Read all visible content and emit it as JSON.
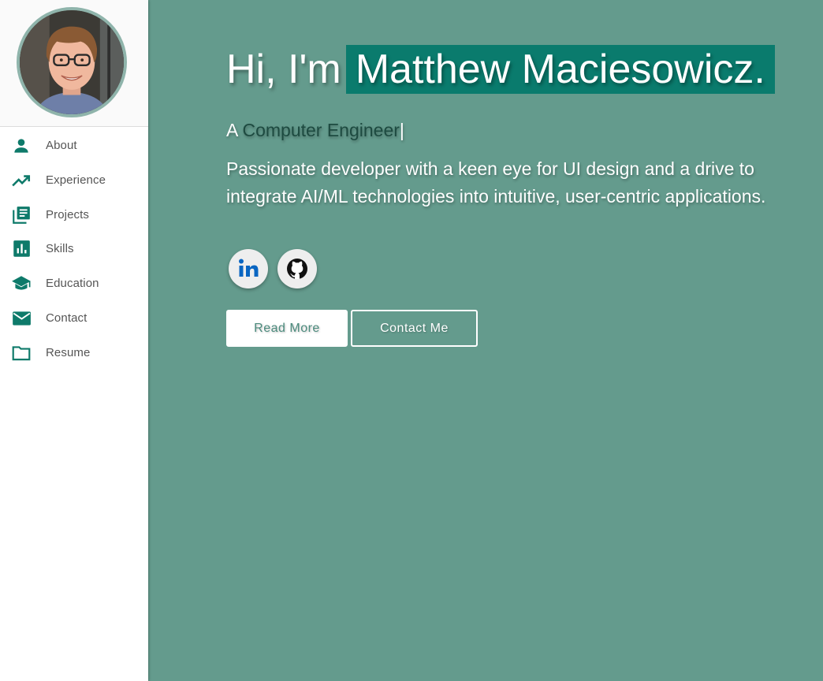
{
  "sidebar": {
    "items": [
      {
        "label": "About",
        "icon": "person-icon"
      },
      {
        "label": "Experience",
        "icon": "trending-up-icon"
      },
      {
        "label": "Projects",
        "icon": "library-books-icon"
      },
      {
        "label": "Skills",
        "icon": "bar-chart-icon"
      },
      {
        "label": "Education",
        "icon": "graduation-cap-icon"
      },
      {
        "label": "Contact",
        "icon": "mail-icon"
      },
      {
        "label": "Resume",
        "icon": "folder-icon"
      }
    ]
  },
  "hero": {
    "greeting_prefix": "Hi, I'm",
    "name": "Matthew Maciesowicz.",
    "role_prefix": "A",
    "role": "Computer Engineer",
    "cursor": "|",
    "tagline": "Passionate developer with a keen eye for UI design and a drive to integrate AI/ML technologies into intuitive, user-centric applications.",
    "socials": [
      {
        "name": "linkedin-icon"
      },
      {
        "name": "github-icon"
      }
    ],
    "read_more_label": "Read More",
    "contact_label": "Contact Me"
  },
  "colors": {
    "background": "#649b8d",
    "accent": "#0a7b6d",
    "icon": "#0e7a6a",
    "sidebar": "#ffffff"
  }
}
